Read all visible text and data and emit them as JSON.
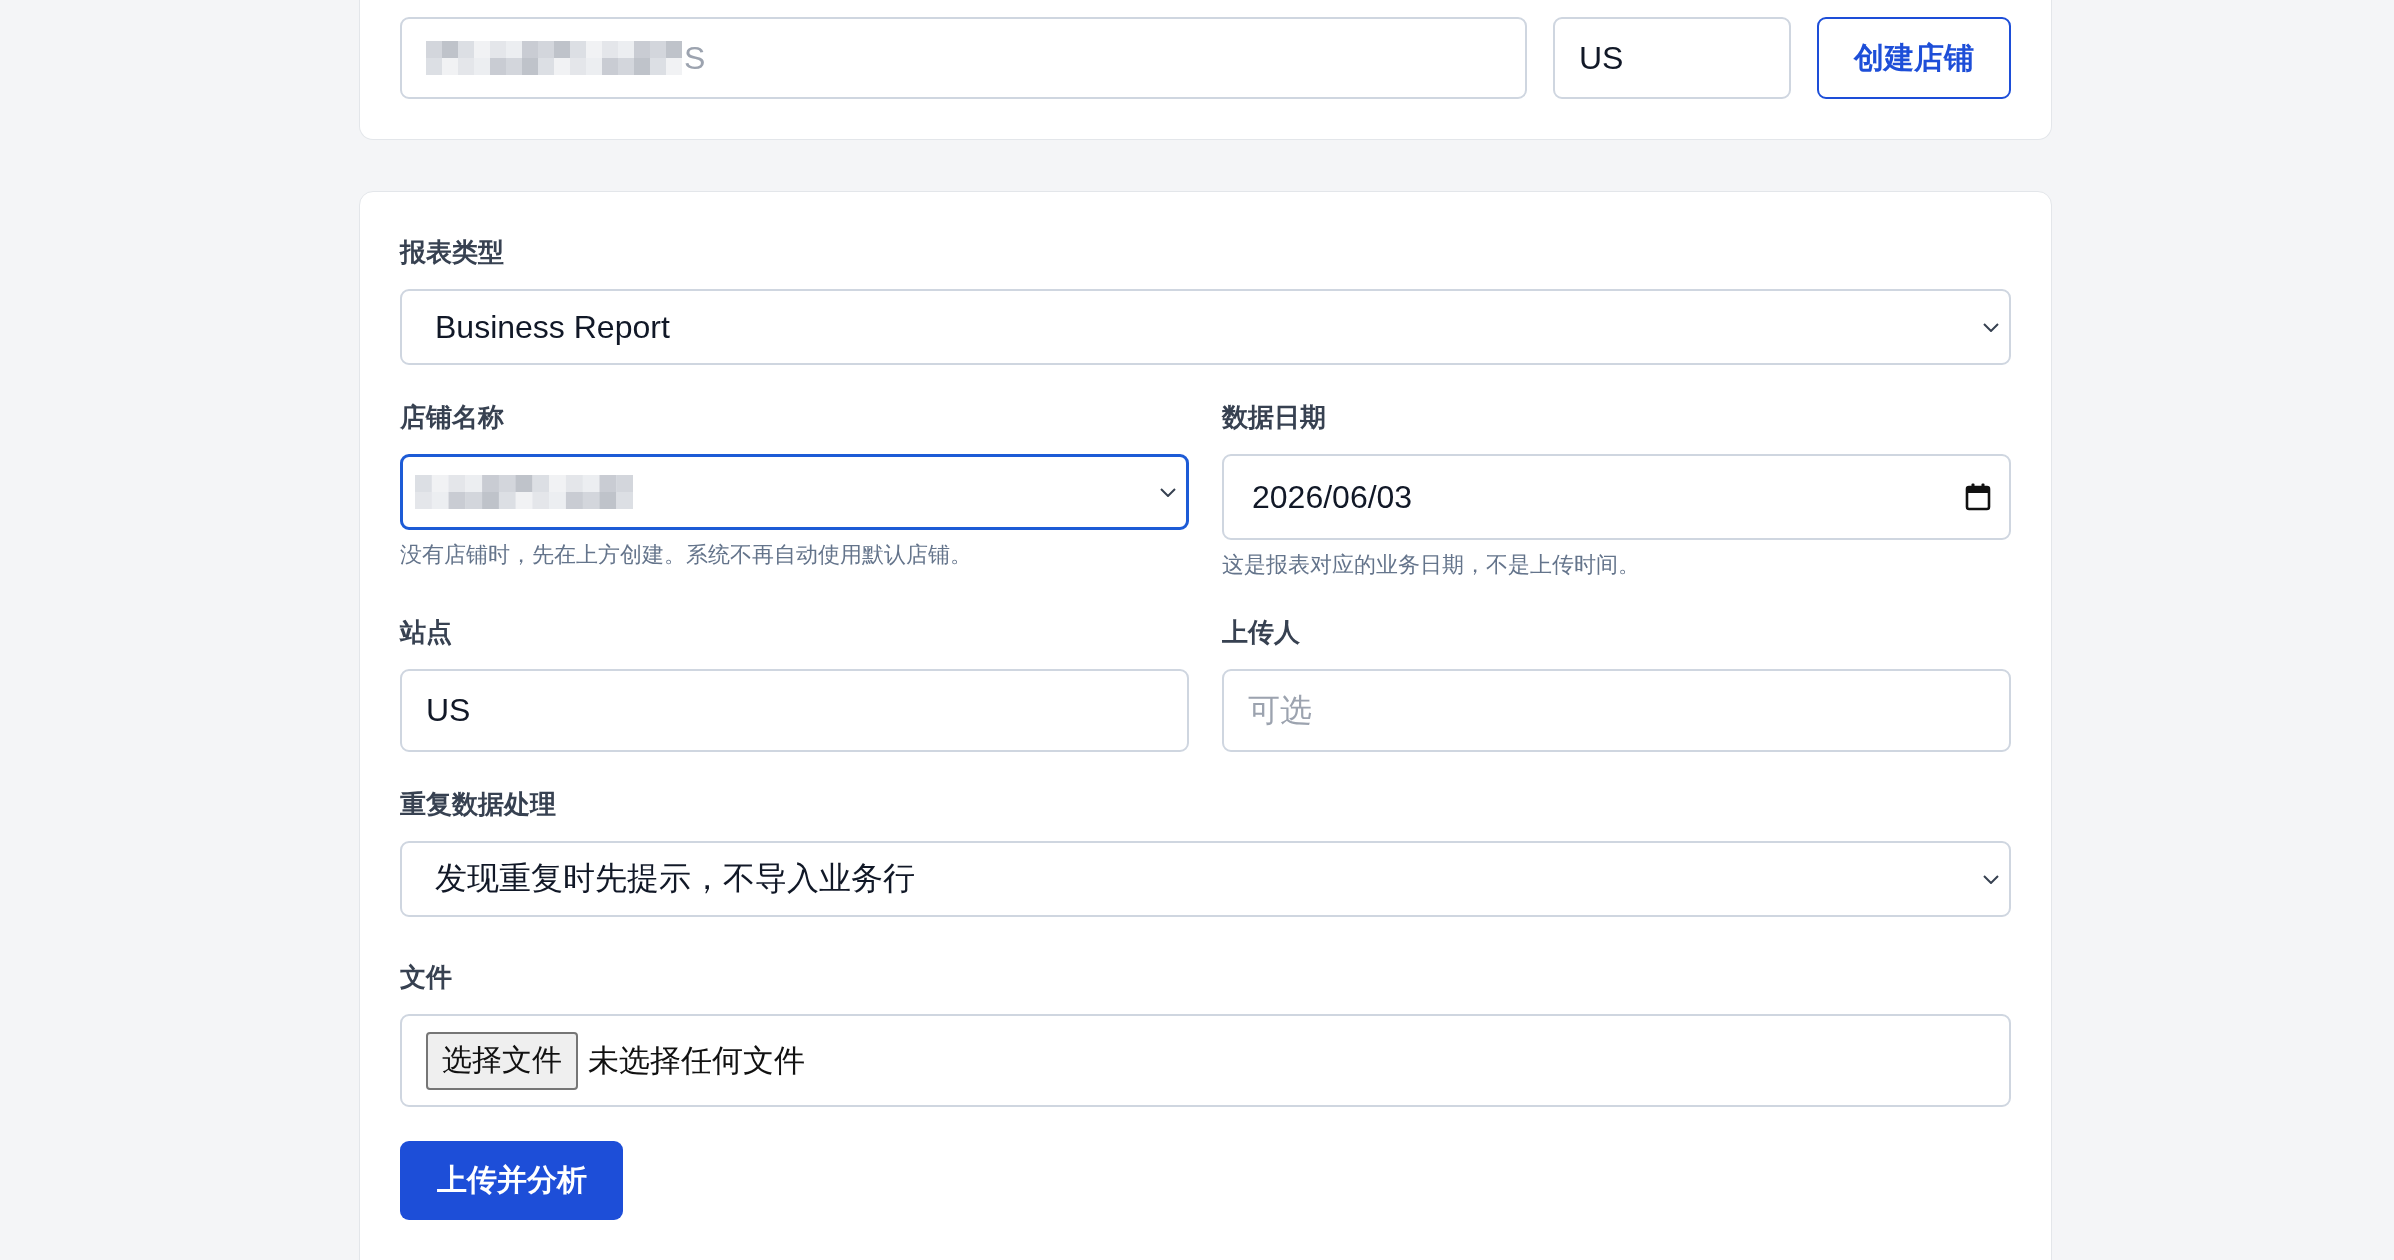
{
  "create_store": {
    "name_field": {
      "redacted": true,
      "placeholder_tail": "S"
    },
    "site_field": {
      "value": "US"
    },
    "button": "创建店铺"
  },
  "upload_form": {
    "rows": [
      {
        "fields": [
          {
            "kind": "select",
            "label": "报表类型",
            "value": "Business Report",
            "focused": false
          }
        ]
      },
      {
        "fields": [
          {
            "kind": "select",
            "label": "店铺名称",
            "redacted": true,
            "focused": true,
            "help": "没有店铺时，先在上方创建。系统不再自动使用默认店铺。"
          },
          {
            "kind": "date",
            "label": "数据日期",
            "value": "2026/06/03",
            "help": "这是报表对应的业务日期，不是上传时间。"
          }
        ]
      },
      {
        "fields": [
          {
            "kind": "text",
            "label": "站点",
            "value": "US"
          },
          {
            "kind": "text",
            "label": "上传人",
            "placeholder": "可选"
          }
        ]
      },
      {
        "fields": [
          {
            "kind": "select",
            "label": "重复数据处理",
            "value": "发现重复时先提示，不导入业务行",
            "focused": false
          }
        ]
      },
      {
        "fields": [
          {
            "kind": "file",
            "label": "文件",
            "button": "选择文件",
            "status": "未选择任何文件"
          }
        ]
      }
    ],
    "submit": "上传并分析"
  }
}
